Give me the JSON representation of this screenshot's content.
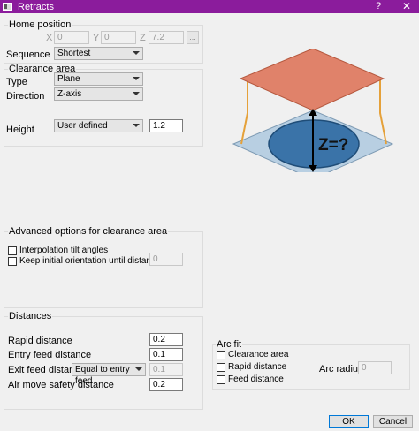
{
  "window": {
    "title": "Retracts",
    "help_glyph": "?",
    "close_glyph": "✕"
  },
  "home_position": {
    "group_label": "Home position",
    "x_label": "X",
    "x_value": "0",
    "y_label": "Y",
    "y_value": "0",
    "z_label": "Z",
    "z_value": "7.2",
    "browse_label": "...",
    "sequence_label": "Sequence",
    "sequence_value": "Shortest"
  },
  "clearance_area": {
    "group_label": "Clearance area",
    "type_label": "Type",
    "type_value": "Plane",
    "direction_label": "Direction",
    "direction_value": "Z-axis",
    "height_label": "Height",
    "height_mode_value": "User defined",
    "height_value": "1.2"
  },
  "illustration": {
    "caption": "Z=?",
    "colors": {
      "plane_fill": "#e0826a",
      "plane_stroke": "#b5583e",
      "base_fill": "#b8cfe2",
      "ellipse_fill": "#3a73a8",
      "link_stroke": "#e5a13a"
    }
  },
  "advanced": {
    "group_label": "Advanced options for clearance area",
    "interp_label": "Interpolation tilt angles",
    "keep_orient_label": "Keep initial orientation until distance",
    "keep_orient_value": "0"
  },
  "distances": {
    "group_label": "Distances",
    "rapid_label": "Rapid distance",
    "rapid_value": "0.2",
    "entry_label": "Entry feed distance",
    "entry_value": "0.1",
    "exit_label": "Exit feed distance",
    "exit_mode_value": "Equal to entry feed",
    "exit_value": "0.1",
    "air_label": "Air move safety distance",
    "air_value": "0.2"
  },
  "arc_fit": {
    "group_label": "Arc fit",
    "clearance_label": "Clearance area",
    "rapid_label": "Rapid distance",
    "feed_label": "Feed distance",
    "radius_label": "Arc radius",
    "radius_value": "0"
  },
  "footer": {
    "ok_label": "OK",
    "cancel_label": "Cancel"
  }
}
